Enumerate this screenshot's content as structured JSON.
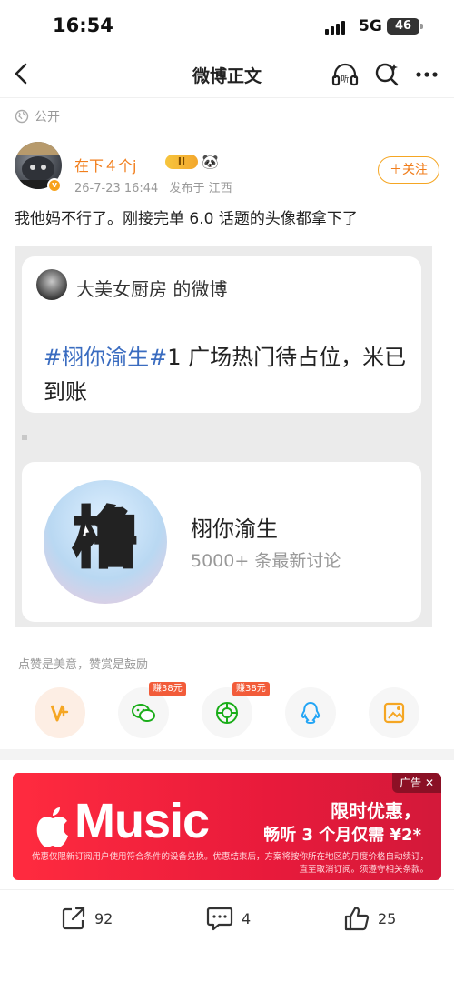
{
  "status_bar": {
    "time": "16:54",
    "network": "5G",
    "battery": "46"
  },
  "nav": {
    "title": "微博正文"
  },
  "post": {
    "visibility": "公开",
    "author": "在下４个j",
    "level_badge": "II",
    "emoji": "🐼",
    "verified_mark": "v",
    "date": "26-7-23 16:44",
    "location_text": "发布于 江西",
    "follow_label": "＋关注",
    "text": "我他妈不行了。刚接完单 6.0 话题的头像都拿下了"
  },
  "image_content": {
    "author_line": "大美女厨房 的微博",
    "hashtag": "#栩你渝生#",
    "text_rest": "1 广场热门待占位，米已到账",
    "topic_glyph": "橹",
    "topic_name": "栩你渝生",
    "topic_count": "5000+ 条最新讨论"
  },
  "encourage_text": "点赞是美意，赞赏是鼓励",
  "reward_tags": {
    "wechat": "赚38元",
    "moments": "赚38元"
  },
  "ad": {
    "label": "广告 ✕",
    "logo": "Music",
    "title1": "限时优惠，",
    "title2": "畅听 3 个月仅需 ¥2*",
    "fine_print": "优惠仅限新订阅用户使用符合条件的设备兑换。优惠结束后，方案将按你所在地区的月度价格自动续订，直至取消订阅。须遵守相关条款。"
  },
  "actions": {
    "repost_count": "92",
    "comment_count": "4",
    "like_count": "25"
  },
  "colors": {
    "accent": "#f17e1c",
    "ad_red": "#e81a3b",
    "link_blue": "#3a6cc0"
  },
  "icons": [
    "back-icon",
    "listen-icon",
    "search-icon",
    "more-icon",
    "globe-icon",
    "repost-icon",
    "comment-icon",
    "like-icon"
  ]
}
